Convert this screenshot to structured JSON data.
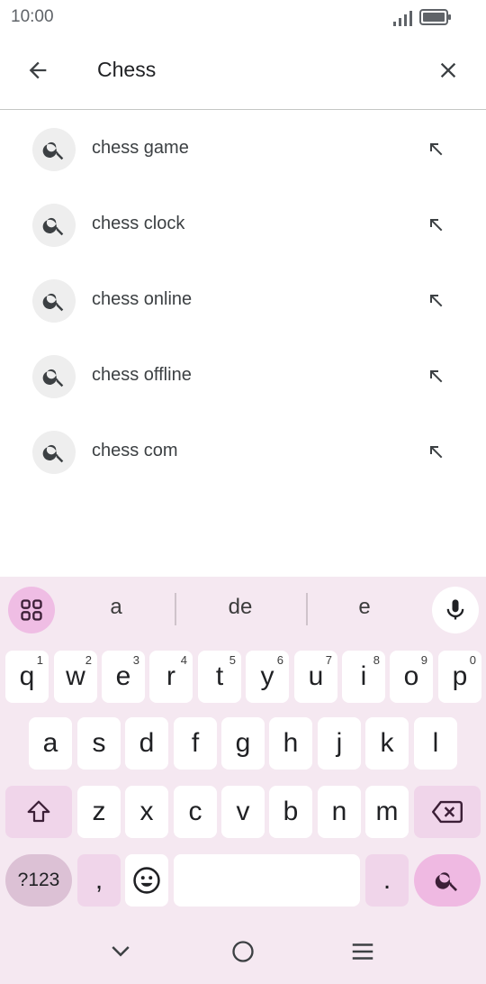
{
  "status": {
    "time": "10:00"
  },
  "search": {
    "query": "Chess"
  },
  "icons": {
    "back": "arrow-back-icon",
    "clear": "close-icon",
    "suggestion": "search-icon",
    "fill": "arrow-up-left-icon",
    "apps": "apps-grid-icon",
    "mic": "mic-icon",
    "shift": "shift-icon",
    "backspace": "backspace-icon",
    "emoji": "emoji-icon",
    "search_action": "search-icon"
  },
  "suggestions": [
    {
      "label": "chess game"
    },
    {
      "label": "chess clock"
    },
    {
      "label": "chess online"
    },
    {
      "label": "chess offline"
    },
    {
      "label": "chess com"
    }
  ],
  "keyboard": {
    "candidates": [
      "a",
      "de",
      "e"
    ],
    "row1": [
      {
        "key": "q",
        "hint": "1"
      },
      {
        "key": "w",
        "hint": "2"
      },
      {
        "key": "e",
        "hint": "3"
      },
      {
        "key": "r",
        "hint": "4"
      },
      {
        "key": "t",
        "hint": "5"
      },
      {
        "key": "y",
        "hint": "6"
      },
      {
        "key": "u",
        "hint": "7"
      },
      {
        "key": "i",
        "hint": "8"
      },
      {
        "key": "o",
        "hint": "9"
      },
      {
        "key": "p",
        "hint": "0"
      }
    ],
    "row2": [
      "a",
      "s",
      "d",
      "f",
      "g",
      "h",
      "j",
      "k",
      "l"
    ],
    "row3": [
      "z",
      "x",
      "c",
      "v",
      "b",
      "n",
      "m"
    ],
    "symbols_label": "?123",
    "comma": ",",
    "period": "."
  },
  "colors": {
    "keyboard_bg": "#f5e8f1",
    "accent": "#efb9e2",
    "modifier": "#f0d5ea"
  }
}
